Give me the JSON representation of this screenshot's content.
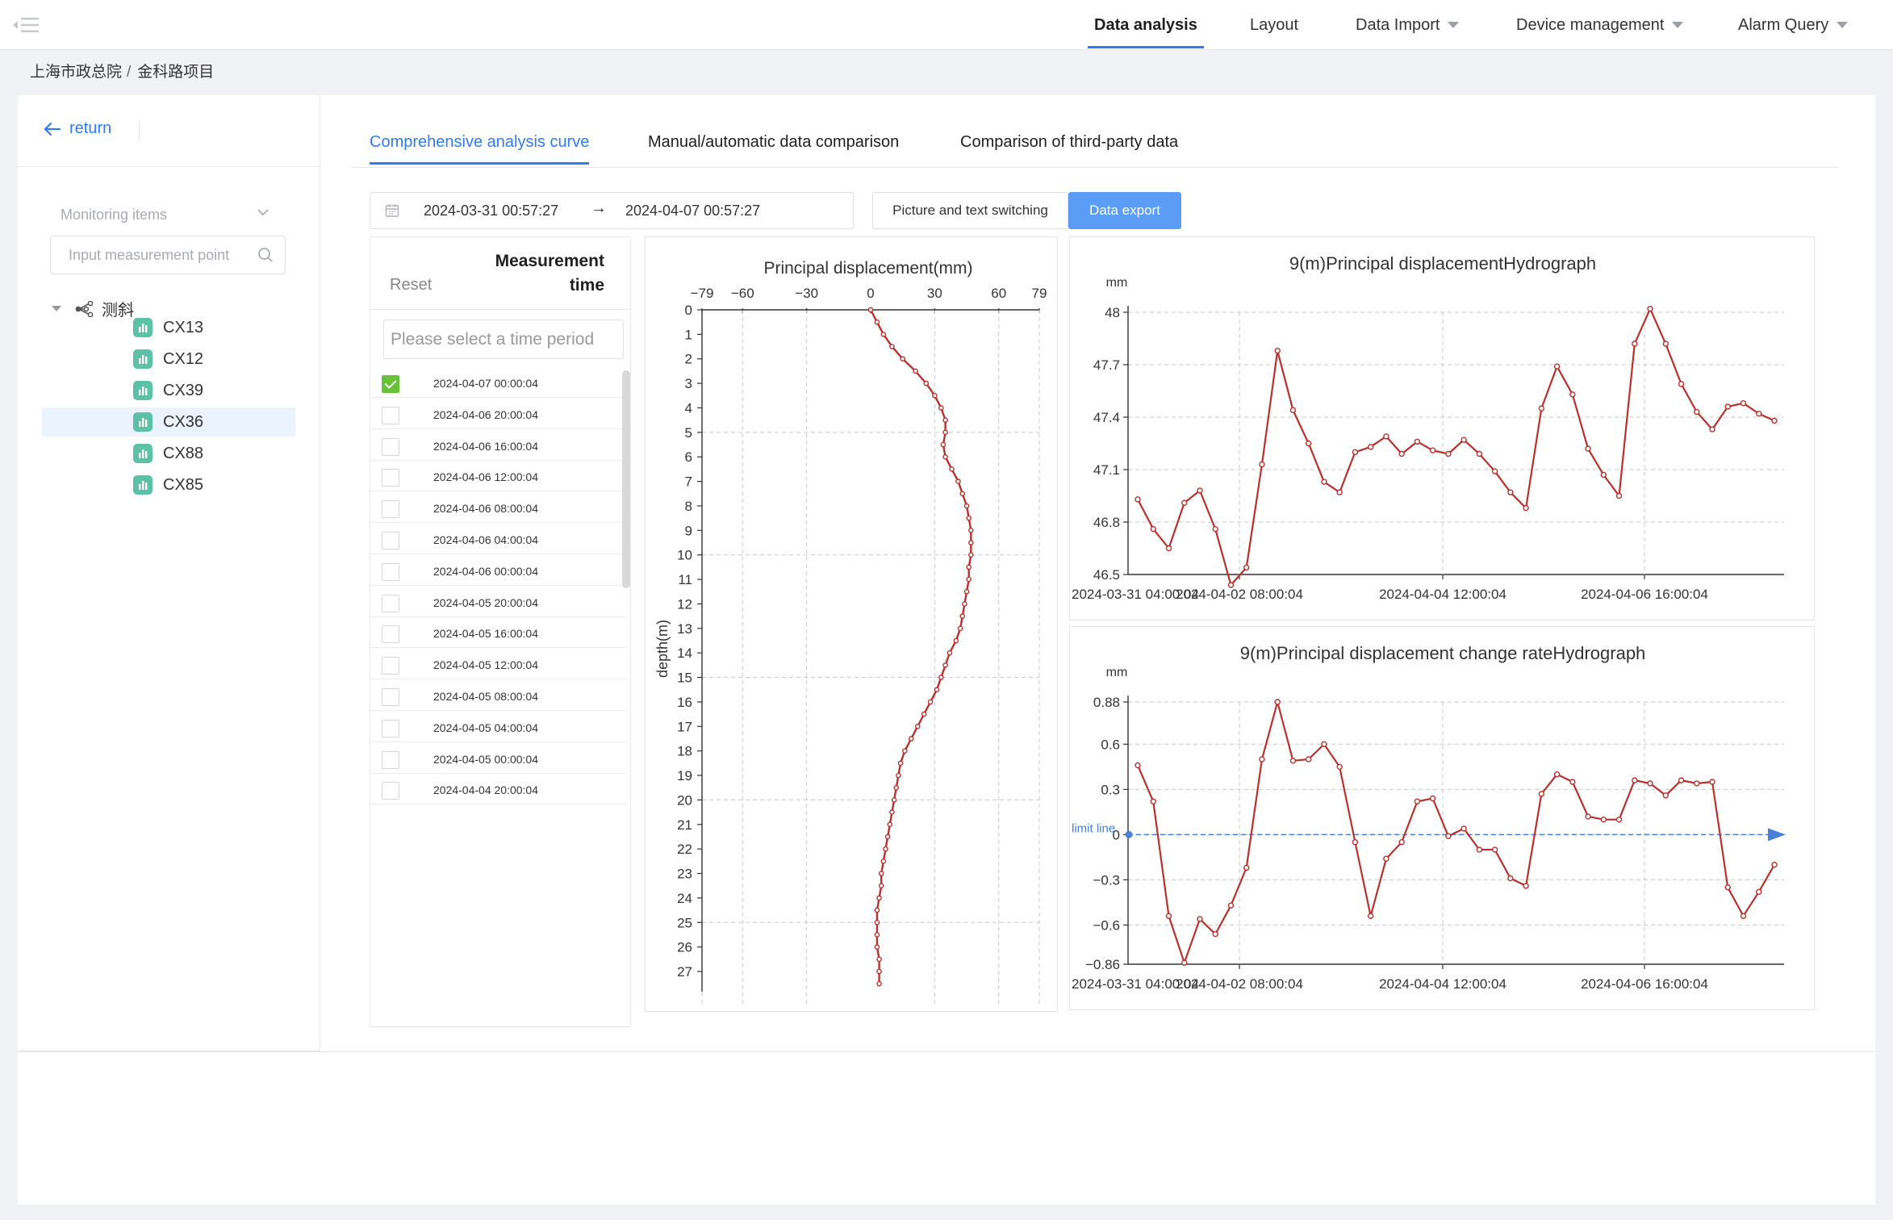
{
  "nav": {
    "items": [
      {
        "label": "Data analysis",
        "active": true,
        "dropdown": false
      },
      {
        "label": "Layout",
        "active": false,
        "dropdown": false
      },
      {
        "label": "Data Import",
        "active": false,
        "dropdown": true
      },
      {
        "label": "Device management",
        "active": false,
        "dropdown": true
      },
      {
        "label": "Alarm Query",
        "active": false,
        "dropdown": true
      }
    ]
  },
  "breadcrumb": {
    "root": "上海市政总院",
    "separator": "/",
    "current": "金科路项目"
  },
  "sidebar": {
    "return_label": "return",
    "monitor_placeholder": "Monitoring items",
    "search_placeholder": "Input measurement point",
    "tree_root": "测斜",
    "items": [
      {
        "label": "CX13",
        "selected": false
      },
      {
        "label": "CX12",
        "selected": false
      },
      {
        "label": "CX39",
        "selected": false
      },
      {
        "label": "CX36",
        "selected": true
      },
      {
        "label": "CX88",
        "selected": false
      },
      {
        "label": "CX85",
        "selected": false
      }
    ]
  },
  "tabs": [
    {
      "label": "Comprehensive analysis curve",
      "active": true
    },
    {
      "label": "Manual/automatic data comparison",
      "active": false
    },
    {
      "label": "Comparison of third-party data",
      "active": false
    }
  ],
  "toolbar": {
    "date_start": "2024-03-31 00:57:27",
    "date_arrow": "→",
    "date_end": "2024-04-07 00:57:27",
    "switch_label": "Picture and text switching",
    "export_label": "Data export"
  },
  "timelist": {
    "reset_label": "Reset",
    "title_line1": "Measurement",
    "title_line2": "time",
    "filter_placeholder": "Please select a time period",
    "rows": [
      {
        "time": "2024-04-07 00:00:04",
        "checked": true
      },
      {
        "time": "2024-04-06 20:00:04",
        "checked": false
      },
      {
        "time": "2024-04-06 16:00:04",
        "checked": false
      },
      {
        "time": "2024-04-06 12:00:04",
        "checked": false
      },
      {
        "time": "2024-04-06 08:00:04",
        "checked": false
      },
      {
        "time": "2024-04-06 04:00:04",
        "checked": false
      },
      {
        "time": "2024-04-06 00:00:04",
        "checked": false
      },
      {
        "time": "2024-04-05 20:00:04",
        "checked": false
      },
      {
        "time": "2024-04-05 16:00:04",
        "checked": false
      },
      {
        "time": "2024-04-05 12:00:04",
        "checked": false
      },
      {
        "time": "2024-04-05 08:00:04",
        "checked": false
      },
      {
        "time": "2024-04-05 04:00:04",
        "checked": false
      },
      {
        "time": "2024-04-05 00:00:04",
        "checked": false
      },
      {
        "time": "2024-04-04 20:00:04",
        "checked": false
      }
    ]
  },
  "colors": {
    "accent": "#2f7bf5",
    "series": "#b8312f",
    "badge": "#5dc1a8",
    "check": "#67c23a"
  },
  "chart_data": [
    {
      "type": "line",
      "title": "Principal displacement(mm)",
      "ylabel": "depth(m)",
      "x_ticks": [
        -79,
        -60,
        -30,
        0,
        30,
        60,
        79
      ],
      "xlim": [
        -79,
        79
      ],
      "ylim": [
        0,
        27
      ],
      "y_reversed": true,
      "grid": true,
      "series": [
        {
          "depth": [
            0,
            0.5,
            1,
            1.5,
            2,
            2.5,
            3,
            3.5,
            4,
            4.5,
            5,
            5.5,
            6,
            6.5,
            7,
            7.5,
            8,
            8.5,
            9,
            9.5,
            10,
            10.5,
            11,
            11.5,
            12,
            12.5,
            13,
            13.5,
            14,
            14.5,
            15,
            15.5,
            16,
            16.5,
            17,
            17.5,
            18,
            18.5,
            19,
            19.5,
            20,
            20.5,
            21,
            21.5,
            22,
            22.5,
            23,
            23.5,
            24,
            24.5,
            25,
            25.5,
            26,
            26.5,
            27,
            27.5
          ],
          "values": [
            0,
            3,
            6,
            10,
            15,
            21,
            26,
            30,
            33,
            35,
            35,
            34,
            35,
            38,
            41,
            43,
            45,
            46,
            47,
            47,
            47,
            46,
            46,
            45,
            44,
            43,
            42,
            40,
            37,
            35,
            33,
            31,
            28,
            25,
            22,
            19,
            16,
            14,
            13,
            12,
            11,
            10,
            9,
            8,
            7,
            6,
            5,
            5,
            4,
            3,
            3,
            3,
            3,
            4,
            4,
            4
          ]
        }
      ]
    },
    {
      "type": "line",
      "title": "9(m)Principal displacementHydrograph",
      "ylabel": "mm",
      "y_ticks": [
        46.5,
        46.8,
        47.1,
        47.4,
        47.7,
        48
      ],
      "ylim": [
        46.5,
        48
      ],
      "x_tick_labels": [
        "2024-03-31 04:00:04",
        "2024-04-02 08:00:04",
        "2024-04-04 12:00:04",
        "2024-04-06 16:00:04"
      ],
      "grid": true,
      "series": [
        {
          "values": [
            46.93,
            46.76,
            46.65,
            46.91,
            46.98,
            46.76,
            46.44,
            46.54,
            47.13,
            47.78,
            47.44,
            47.25,
            47.03,
            46.97,
            47.2,
            47.23,
            47.29,
            47.19,
            47.26,
            47.21,
            47.19,
            47.27,
            47.19,
            47.09,
            46.97,
            46.88,
            47.45,
            47.69,
            47.53,
            47.22,
            47.07,
            46.95,
            47.82,
            48.02,
            47.82,
            47.59,
            47.43,
            47.33,
            47.46,
            47.48,
            47.42,
            47.38
          ]
        }
      ]
    },
    {
      "type": "line",
      "title": "9(m)Principal displacement change rateHydrograph",
      "ylabel": "mm",
      "y_ticks": [
        -0.86,
        -0.6,
        -0.3,
        0,
        0.3,
        0.6,
        0.88
      ],
      "ylim": [
        -0.86,
        0.88
      ],
      "x_tick_labels": [
        "2024-03-31 04:00:04",
        "2024-04-02 08:00:04",
        "2024-04-04 12:00:04",
        "2024-04-06 16:00:04"
      ],
      "grid": true,
      "limit_line_label": "limit line",
      "series": [
        {
          "values": [
            0.46,
            0.22,
            -0.54,
            -0.85,
            -0.56,
            -0.66,
            -0.47,
            -0.22,
            0.5,
            0.88,
            0.49,
            0.5,
            0.6,
            0.45,
            -0.05,
            -0.54,
            -0.16,
            -0.05,
            0.22,
            0.24,
            -0.01,
            0.04,
            -0.1,
            -0.1,
            -0.29,
            -0.34,
            0.27,
            0.4,
            0.35,
            0.12,
            0.1,
            0.1,
            0.36,
            0.34,
            0.26,
            0.36,
            0.34,
            0.35,
            -0.35,
            -0.54,
            -0.38,
            -0.2
          ]
        }
      ]
    }
  ]
}
